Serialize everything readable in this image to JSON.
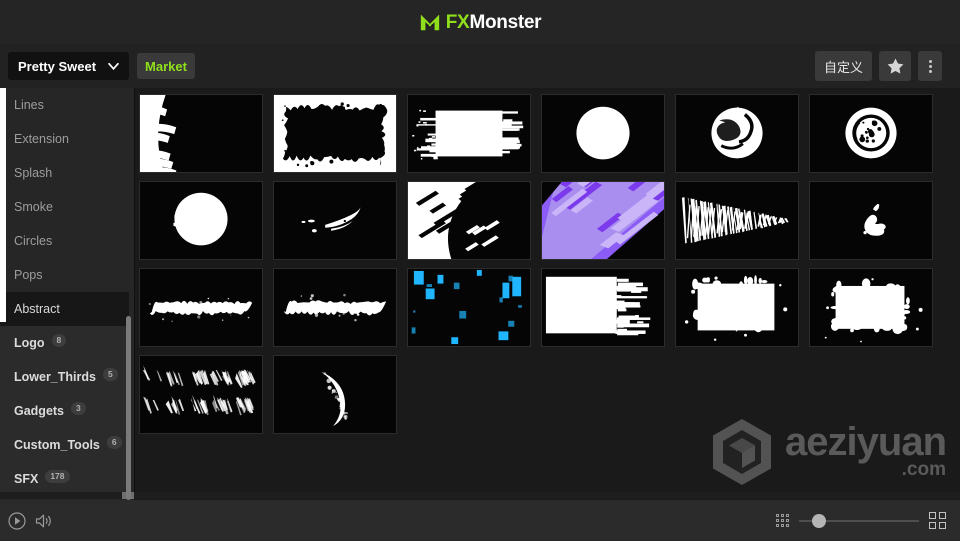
{
  "app": {
    "logo_icon": "fxmonster-m-icon",
    "logo_fx": "FX",
    "logo_monster": "Monster",
    "brand_green": "#8fe01b"
  },
  "toolbar": {
    "project_label": "Pretty Sweet",
    "chevron_icon": "chevron-down-icon",
    "market_label": "Market",
    "customize_label": "自定义",
    "favorite_icon": "star-icon",
    "more_icon": "kebab-menu-icon"
  },
  "sidebar": {
    "sub_items": [
      {
        "label": "Lines",
        "active": false
      },
      {
        "label": "Extension",
        "active": false
      },
      {
        "label": "Splash",
        "active": false
      },
      {
        "label": "Smoke",
        "active": false
      },
      {
        "label": "Circles",
        "active": false
      },
      {
        "label": "Pops",
        "active": false
      },
      {
        "label": "Abstract",
        "active": true
      }
    ],
    "groups": [
      {
        "label": "Logo",
        "count": "8"
      },
      {
        "label": "Lower_Thirds",
        "count": "5"
      },
      {
        "label": "Gadgets",
        "count": "3"
      },
      {
        "label": "Custom_Tools",
        "count": "6"
      },
      {
        "label": "SFX",
        "count": "178"
      }
    ]
  },
  "grid": {
    "items": [
      {
        "name": "brush-strokes-left-edge",
        "art": "strokes-left",
        "accent": "#ffffff"
      },
      {
        "name": "rough-ink-block",
        "art": "ink-block",
        "accent": "#ffffff"
      },
      {
        "name": "glitch-bar-horizontal",
        "art": "glitch-bar",
        "accent": "#ffffff"
      },
      {
        "name": "solid-white-circle",
        "art": "circle-solid",
        "accent": "#ffffff"
      },
      {
        "name": "swirl-paint-circle",
        "art": "circle-swirl",
        "accent": "#ffffff"
      },
      {
        "name": "dotted-ring-circle",
        "art": "circle-ring-dots",
        "accent": "#ffffff"
      },
      {
        "name": "soft-round-blob",
        "art": "blob-round",
        "accent": "#ffffff"
      },
      {
        "name": "paint-flick-small",
        "art": "flick-small",
        "accent": "#ffffff"
      },
      {
        "name": "diagonal-brush-sweep",
        "art": "diagonal-sweep",
        "accent": "#ffffff"
      },
      {
        "name": "purple-diagonal-streaks",
        "art": "purple-streaks",
        "accent": "#8b5cf6"
      },
      {
        "name": "scribble-taper-line",
        "art": "scribble-taper",
        "accent": "#ffffff"
      },
      {
        "name": "ink-splat-tiny",
        "art": "splat-tiny",
        "accent": "#ffffff"
      },
      {
        "name": "brush-bar-horizontal-a",
        "art": "brush-bar",
        "accent": "#ffffff"
      },
      {
        "name": "brush-bar-horizontal-b",
        "art": "brush-bar",
        "accent": "#ffffff"
      },
      {
        "name": "blue-glitch-fragments",
        "art": "blue-glitch",
        "accent": "#1fb6ff"
      },
      {
        "name": "glitch-panel-right-edge",
        "art": "glitch-panel",
        "accent": "#ffffff"
      },
      {
        "name": "splatter-rect-a",
        "art": "splatter-rect",
        "accent": "#ffffff"
      },
      {
        "name": "splatter-rect-b",
        "art": "splatter-rect2",
        "accent": "#ffffff"
      },
      {
        "name": "scribble-grid-marks",
        "art": "scribble-grid",
        "accent": "#ffffff"
      },
      {
        "name": "crescent-brush-arc",
        "art": "crescent",
        "accent": "#ffffff"
      }
    ]
  },
  "watermark": {
    "logo_icon": "aeziyuan-cube-icon",
    "main": "aeziyuan",
    "sub": ".com"
  },
  "bottombar": {
    "play_icon": "play-circle-icon",
    "volume_icon": "speaker-volume-icon",
    "small_grid_icon": "small-grid-view-icon",
    "large_grid_icon": "large-grid-view-icon",
    "zoom_slider_value": 13
  }
}
